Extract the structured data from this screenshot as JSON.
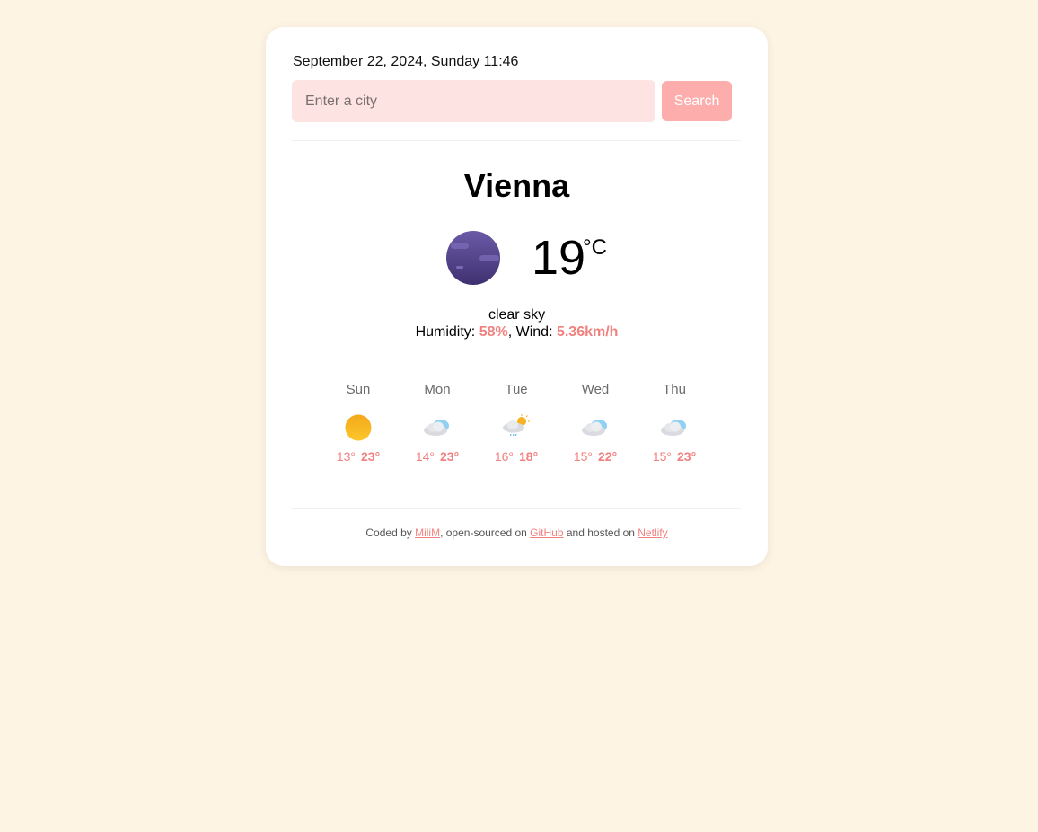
{
  "header": {
    "datetime": "September 22, 2024, Sunday 11:46"
  },
  "search": {
    "placeholder": "Enter a city",
    "value": "",
    "button_label": "Search"
  },
  "current": {
    "city": "Vienna",
    "icon": "night-clear-moon-icon",
    "temperature": "19",
    "unit": "°C",
    "description": "clear sky",
    "humidity_label": "Humidity: ",
    "humidity": "58%",
    "wind_label": ", Wind: ",
    "wind": "5.36km/h"
  },
  "forecast": [
    {
      "day": "Sun",
      "icon": "sun-icon",
      "min": "13°",
      "max": "23°"
    },
    {
      "day": "Mon",
      "icon": "cloud-icon",
      "min": "14°",
      "max": "23°"
    },
    {
      "day": "Tue",
      "icon": "rain-sun-icon",
      "min": "16°",
      "max": "18°"
    },
    {
      "day": "Wed",
      "icon": "cloud-icon",
      "min": "15°",
      "max": "22°"
    },
    {
      "day": "Thu",
      "icon": "cloud-icon",
      "min": "15°",
      "max": "23°"
    }
  ],
  "footer": {
    "prefix": "Coded by ",
    "author": "MiliM",
    "middle1": ", open-sourced on ",
    "github": "GitHub",
    "middle2": " and hosted on ",
    "netlify": "Netlify"
  },
  "colors": {
    "background": "#fef4e4",
    "accent": "#f0817f",
    "input_bg": "#fde3e2",
    "button_bg": "#fdaeac"
  }
}
